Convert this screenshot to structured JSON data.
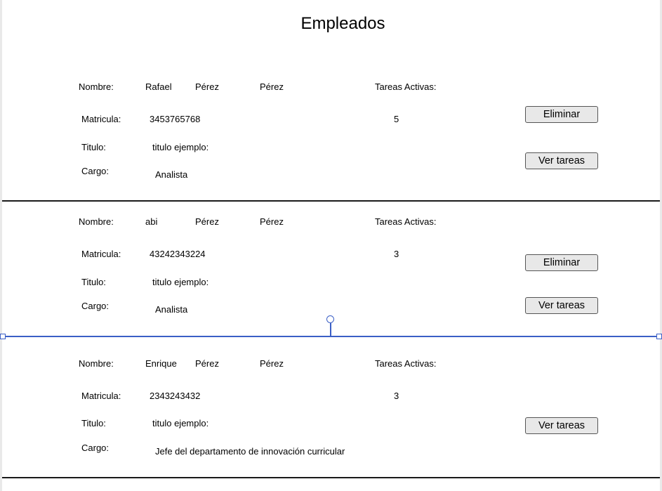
{
  "page": {
    "title": "Empleados"
  },
  "labels": {
    "nombre": "Nombre:",
    "tareas_activas": "Tareas Activas:",
    "matricula": "Matricula:",
    "titulo": "Titulo:",
    "cargo": "Cargo:",
    "eliminar": "Eliminar",
    "ver_tareas": "Ver tareas"
  },
  "employees": [
    {
      "nombre": "Rafael",
      "apellido_paterno": "Pérez",
      "apellido_materno": "Pérez",
      "matricula": "3453765768",
      "tareas_activas": "5",
      "titulo": "titulo ejemplo:",
      "cargo": "Analista",
      "show_eliminar": true
    },
    {
      "nombre": "abi",
      "apellido_paterno": "Pérez",
      "apellido_materno": "Pérez",
      "matricula": "43242343224",
      "tareas_activas": "3",
      "titulo": "titulo ejemplo:",
      "cargo": "Analista",
      "show_eliminar": true
    },
    {
      "nombre": "Enrique",
      "apellido_paterno": "Pérez",
      "apellido_materno": "Pérez",
      "matricula": "2343243432",
      "tareas_activas": "3",
      "titulo": "titulo ejemplo:",
      "cargo": "Jefe del departamento de innovación curricular",
      "show_eliminar": false
    }
  ],
  "colors": {
    "selection": "#3b5fc6",
    "button_bg": "#e8e8e8",
    "divider": "#1a1a1a"
  }
}
